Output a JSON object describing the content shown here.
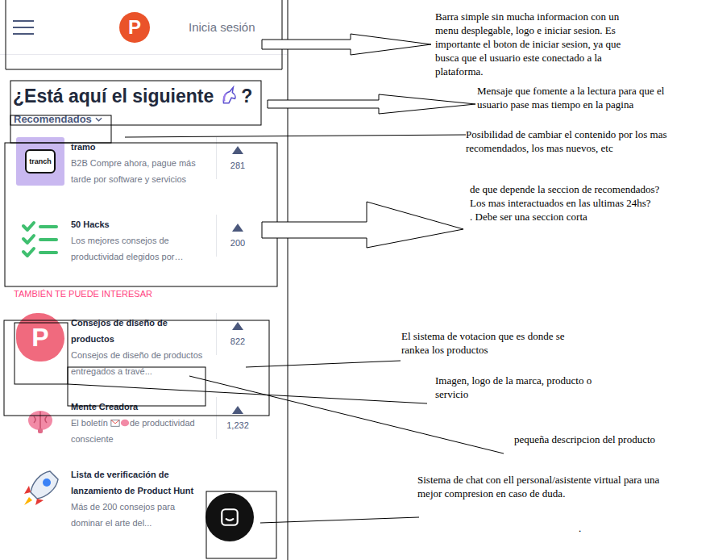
{
  "header": {
    "logo": "P",
    "login": "Inicia sesión"
  },
  "heading": {
    "text": "¿Está aquí el siguiente",
    "suffix": "?"
  },
  "sort": {
    "label": "Recomendados"
  },
  "recommended": [
    {
      "kind": "tranch",
      "logo_text": "tranch",
      "name": "tramo",
      "description": "B2B Compre ahora, pague más tarde por software y servicios",
      "votes": "281"
    },
    {
      "kind": "checklist",
      "name": "50 Hacks",
      "description": "Los mejores consejos de productividad elegidos por…",
      "votes": "200"
    }
  ],
  "section_label": "TAMBIÉN TE PUEDE INTERESAR",
  "more": [
    {
      "kind": "p",
      "logo_text": "P",
      "name": "Consejos de diseño de productos",
      "description": "Consejos de diseño de productos entregados a travé...",
      "votes": "822"
    },
    {
      "kind": "brain",
      "name": "Mente Creadora",
      "description": "El boletín",
      "description_after": "de productividad consciente",
      "votes": "1,232"
    },
    {
      "kind": "rocket",
      "name": "Lista de verificación de lanzamiento de Product Hunt",
      "description": "Más de 200 consejos para dominar el arte del...",
      "votes": null
    }
  ],
  "annotations": [
    {
      "lines": [
        "Barra simple sin mucha informacion con un",
        "menu desplegable, logo e iniciar sesion. Es",
        "importante el boton de iniciar sesion, ya que",
        "busca que el usuario este conectado a la",
        "plataforma."
      ]
    },
    {
      "lines": [
        "Mensaje que fomente a la lectura para que el",
        "usuario pase mas tiempo en la pagina"
      ]
    },
    {
      "lines": [
        "Posibilidad de cambiar el contenido por los mas",
        "recomendados, los mas nuevos, etc"
      ]
    },
    {
      "lines": [
        "de que depende la seccion de recomendados?",
        "Los mas interactuados en las ultimas 24hs?",
        ". Debe ser una seccion corta"
      ]
    },
    {
      "lines": [
        "El sistema de votacion que es donde se",
        "rankea los productos"
      ]
    },
    {
      "lines": [
        "Imagen, logo de la marca, producto o",
        "servicio"
      ]
    },
    {
      "lines": [
        "pequeña descripcion del producto"
      ]
    },
    {
      "lines": [
        "Sistema de chat con ell personal/asistente virtual para una",
        "mejor compresion en caso de duda."
      ]
    },
    {
      "lines": [
        "."
      ]
    }
  ]
}
